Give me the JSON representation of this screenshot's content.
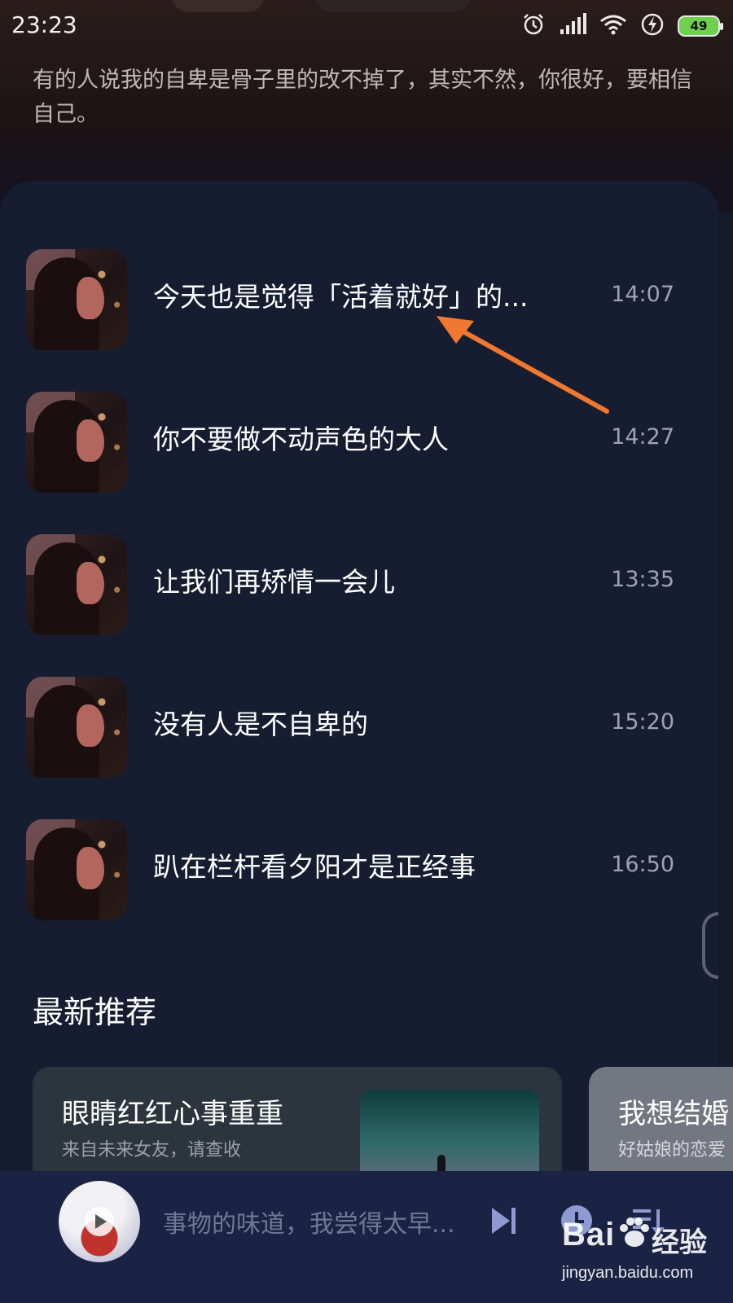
{
  "status_bar": {
    "time": "23:23",
    "battery": "49",
    "icons": [
      "alarm-icon",
      "signal-icon",
      "wifi-icon",
      "charging-icon",
      "battery-icon"
    ]
  },
  "header": {
    "quote": "有的人说我的自卑是骨子里的改不掉了，其实不然，你很好，要相信自己。"
  },
  "list": {
    "items": [
      {
        "title": "今天也是觉得「活着就好」的...",
        "time": "14:07"
      },
      {
        "title": "你不要做不动声色的大人",
        "time": "14:27"
      },
      {
        "title": "让我们再矫情一会儿",
        "time": "13:35"
      },
      {
        "title": "没有人是不自卑的",
        "time": "15:20"
      },
      {
        "title": "趴在栏杆看夕阳才是正经事",
        "time": "16:50"
      }
    ]
  },
  "recommend": {
    "section_title": "最新推荐",
    "cards": [
      {
        "title": "眼睛红红心事重重",
        "subtitle": "来自未来女友，请查收"
      },
      {
        "title": "我想结婚",
        "subtitle": "好姑娘的恋爱"
      }
    ]
  },
  "player": {
    "now_playing": "事物的味道，我尝得太早..."
  },
  "watermark": {
    "logo": "Bai",
    "cn": "经验",
    "url": "jingyan.baidu.com"
  },
  "colors": {
    "panel": "#161d31",
    "player_bg": "#1b2344",
    "annotation_arrow": "#f07830",
    "battery_fill": "#6fcf4f"
  }
}
